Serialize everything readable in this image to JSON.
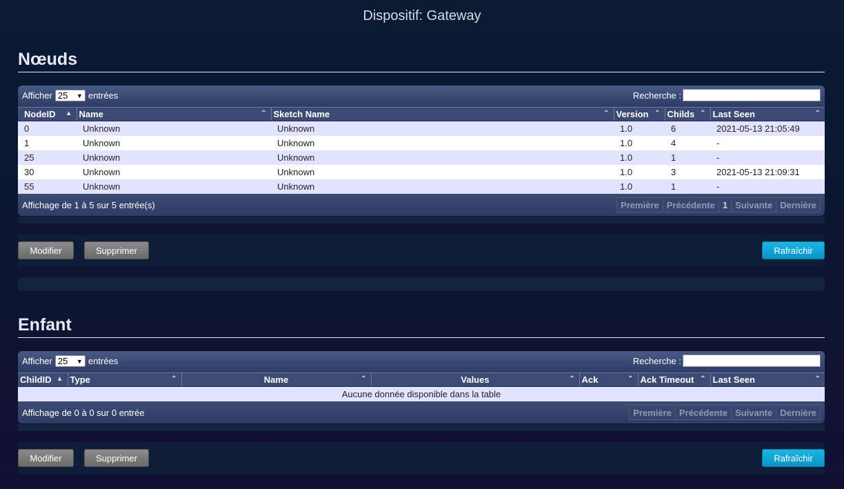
{
  "page": {
    "title": "Dispositif: Gateway"
  },
  "nodes": {
    "heading": "Nœuds",
    "length_label_before": "Afficher",
    "length_value": "25",
    "length_label_after": "entrées",
    "search_label": "Recherche :",
    "columns": [
      "NodeID",
      "Name",
      "Sketch Name",
      "Version",
      "Childs",
      "Last Seen"
    ],
    "rows": [
      [
        "0",
        "Unknown",
        "Unknown",
        "1.0",
        "6",
        "2021-05-13 21:05:49"
      ],
      [
        "1",
        "Unknown",
        "Unknown",
        "1.0",
        "4",
        "-"
      ],
      [
        "25",
        "Unknown",
        "Unknown",
        "1.0",
        "1",
        "-"
      ],
      [
        "30",
        "Unknown",
        "Unknown",
        "1.0",
        "3",
        "2021-05-13 21:09:31"
      ],
      [
        "55",
        "Unknown",
        "Unknown",
        "1.0",
        "1",
        "-"
      ]
    ],
    "info": "Affichage de 1 à 5 sur 5 entrée(s)",
    "paging": {
      "first": "Première",
      "prev": "Précédente",
      "current": "1",
      "next": "Suivante",
      "last": "Dernière"
    },
    "buttons": {
      "modify": "Modifier",
      "delete": "Supprimer",
      "refresh": "Rafraîchir"
    }
  },
  "children": {
    "heading": "Enfant",
    "length_label_before": "Afficher",
    "length_value": "25",
    "length_label_after": "entrées",
    "search_label": "Recherche :",
    "columns": [
      "ChildID",
      "Type",
      "Name",
      "Values",
      "Ack",
      "Ack Timeout",
      "Last Seen"
    ],
    "empty_message": "Aucune donnée disponible dans la table",
    "info": "Affichage de 0 à 0 sur 0 entrée",
    "paging": {
      "first": "Première",
      "prev": "Précédente",
      "next": "Suivante",
      "last": "Dernière"
    },
    "buttons": {
      "modify": "Modifier",
      "delete": "Supprimer",
      "refresh": "Rafraîchir"
    }
  },
  "icons": {
    "sort_asc": "sort-asc-icon",
    "sort_both": "sort-both-icon",
    "select_caret": "chevron-down-icon"
  },
  "colors": {
    "accent": "#0a9fd4",
    "row_odd": "#e2e4ff",
    "row_even": "#ffffff",
    "header": "#3d4b74"
  }
}
